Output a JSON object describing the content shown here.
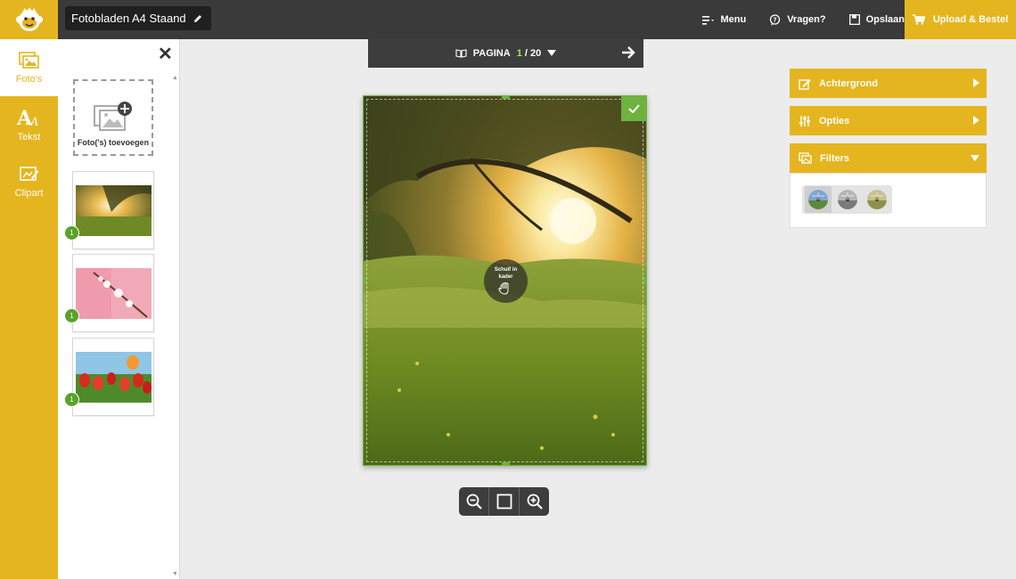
{
  "header": {
    "doc_title": "Fotobladen A4 Staand",
    "actions": {
      "menu": "Menu",
      "questions": "Vragen?",
      "save": "Opslaan"
    },
    "order_button": "Upload & Bestel"
  },
  "rail": {
    "items": [
      {
        "label": "Foto's",
        "icon": "photos-icon",
        "active": true
      },
      {
        "label": "Tekst",
        "icon": "text-icon",
        "active": false
      },
      {
        "label": "Clipart",
        "icon": "clipart-icon",
        "active": false
      }
    ]
  },
  "photo_panel": {
    "add_label": "Foto('s) toevoegen",
    "photos": [
      {
        "name": "sunset meadow",
        "badge": "1"
      },
      {
        "name": "cherry blossom",
        "badge": "1"
      },
      {
        "name": "tulips",
        "badge": "1"
      }
    ]
  },
  "page_nav": {
    "label": "PAGINA",
    "current": "1",
    "separator": "/",
    "total": "20"
  },
  "canvas": {
    "drag_hint_line1": "Schuif in",
    "drag_hint_line2": "kader"
  },
  "properties": {
    "background": "Achtergrond",
    "options": "Opties",
    "filters": "Filters"
  },
  "colors": {
    "accent": "#e4b51e",
    "dark": "#3a3a3a",
    "green": "#6fb23f"
  }
}
